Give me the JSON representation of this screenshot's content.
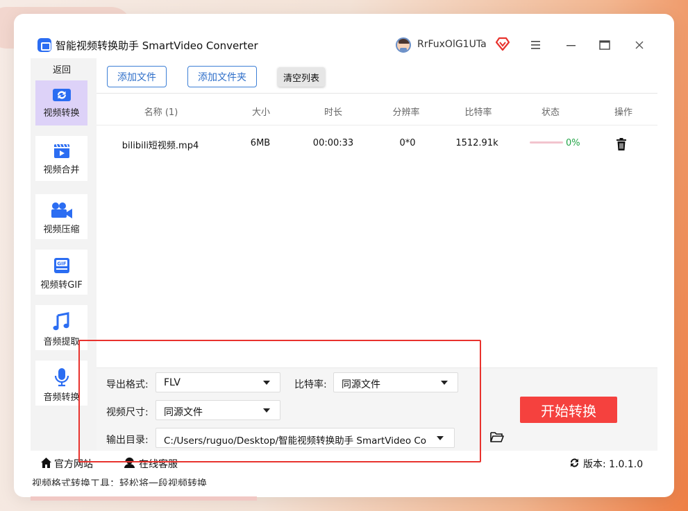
{
  "app": {
    "title": "智能视频转换助手 SmartVideo Converter",
    "username": "RrFuxOlG1UTa"
  },
  "icons": {
    "app_logo": "video-convert-icon",
    "avatar": "user-avatar",
    "vip": "diamond-icon",
    "menu": "hamburger-menu-icon",
    "minimize": "minimize-icon",
    "maximize": "maximize-icon",
    "close": "close-icon"
  },
  "colors": {
    "accent": "#2b6df2",
    "active_nav_bg": "#ddd2f8",
    "start_button": "#f5413e",
    "progress_done": "#23a447",
    "highlight_box": "#e8322d"
  },
  "sidebar": {
    "back": "返回",
    "items": [
      {
        "label": "视频转换",
        "icon": "video-convert-icon",
        "active": true
      },
      {
        "label": "视频合并",
        "icon": "video-merge-icon",
        "active": false
      },
      {
        "label": "视频压缩",
        "icon": "video-compress-icon",
        "active": false
      },
      {
        "label": "视频转GIF",
        "icon": "gif-icon",
        "active": false
      },
      {
        "label": "音频提取",
        "icon": "music-note-icon",
        "active": false
      },
      {
        "label": "音频转换",
        "icon": "microphone-icon",
        "active": false
      }
    ]
  },
  "toolbar": {
    "add_file": "添加文件",
    "add_folder": "添加文件夹",
    "clear_list": "清空列表"
  },
  "table": {
    "headers": [
      "名称 (1)",
      "大小",
      "时长",
      "分辨率",
      "比特率",
      "状态",
      "操作"
    ],
    "rows": [
      {
        "name": "bilibili短视频.mp4",
        "size": "6MB",
        "duration": "00:00:33",
        "resolution": "0*0",
        "bitrate": "1512.91k",
        "progress": 0,
        "progress_text": "0%"
      }
    ]
  },
  "settings": {
    "format_label": "导出格式:",
    "format_value": "FLV",
    "bitrate_label": "比特率:",
    "bitrate_value": "同源文件",
    "size_label": "视频尺寸:",
    "size_value": "同源文件",
    "output_label": "输出目录:",
    "output_value": "C:/Users/ruguo/Desktop/智能视频转换助手 SmartVideo Co"
  },
  "start_button": "开始转换",
  "statusbar": {
    "website": "官方网站",
    "support": "在线客服",
    "version": "版本: 1.0.1.0"
  },
  "page_below": "视频格式转换工具：轻松将一段视频转换"
}
